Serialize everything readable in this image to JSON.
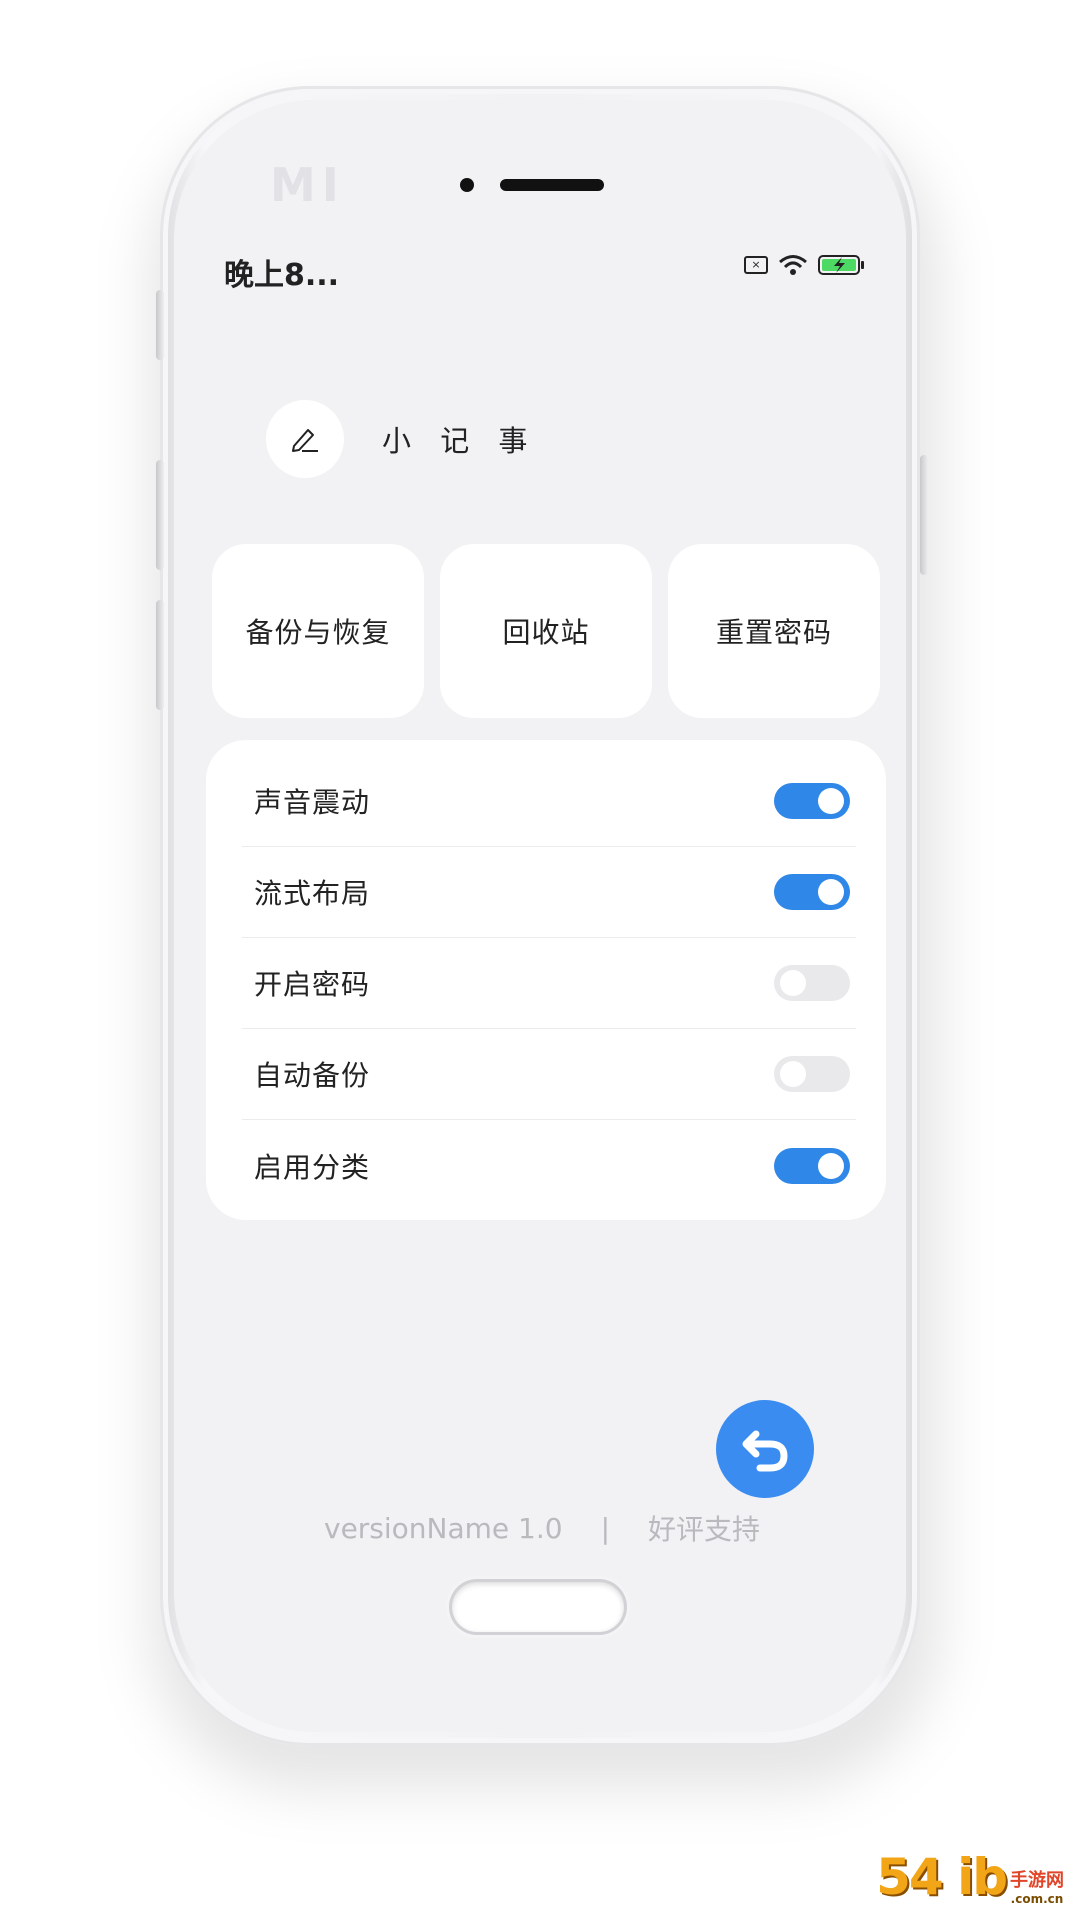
{
  "device": {
    "brand_logo": "MI"
  },
  "status_bar": {
    "time": "晚上8..."
  },
  "app": {
    "title": "小 记 事",
    "avatar_icon": "pencil-icon"
  },
  "cards": [
    {
      "label": "备份与恢复"
    },
    {
      "label": "回收站"
    },
    {
      "label": "重置密码"
    }
  ],
  "settings": [
    {
      "label": "声音震动",
      "enabled": true
    },
    {
      "label": "流式布局",
      "enabled": true
    },
    {
      "label": "开启密码",
      "enabled": false
    },
    {
      "label": "自动备份",
      "enabled": false
    },
    {
      "label": "启用分类",
      "enabled": true
    }
  ],
  "footer": {
    "version": "versionName 1.0",
    "separator": "|",
    "rate_link": "好评支持"
  },
  "watermark": {
    "main": "54 ib",
    "cn": "手游网",
    "domain": ".com.cn"
  },
  "colors": {
    "accent": "#2f87e8",
    "fab": "#3b8cf1",
    "screen_bg": "#f2f2f5",
    "card_bg": "#ffffff"
  }
}
